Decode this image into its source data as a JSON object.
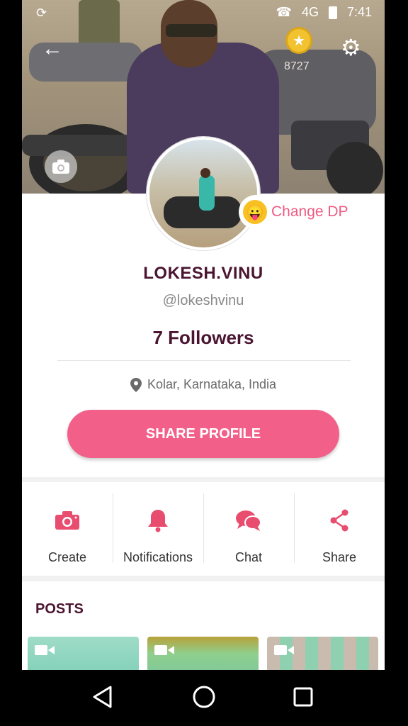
{
  "status_bar": {
    "network": "4G",
    "time": "7:41"
  },
  "header": {
    "coins": "8727",
    "back_icon": "back-arrow-icon",
    "settings_icon": "gear-icon"
  },
  "profile": {
    "change_dp_label": "Change DP",
    "name": "LOKESH.VINU",
    "handle": "@lokeshvinu",
    "followers": "7 Followers",
    "location": "Kolar, Karnataka, India",
    "share_profile_label": "SHARE PROFILE"
  },
  "actions": [
    {
      "label": "Create",
      "icon": "camera-icon"
    },
    {
      "label": "Notifications",
      "icon": "bell-icon"
    },
    {
      "label": "Chat",
      "icon": "chat-icon"
    },
    {
      "label": "Share",
      "icon": "share-icon"
    }
  ],
  "posts": {
    "title": "POSTS"
  },
  "colors": {
    "accent": "#f2608a",
    "name_text": "#4a1530",
    "coin": "#f2c230"
  }
}
